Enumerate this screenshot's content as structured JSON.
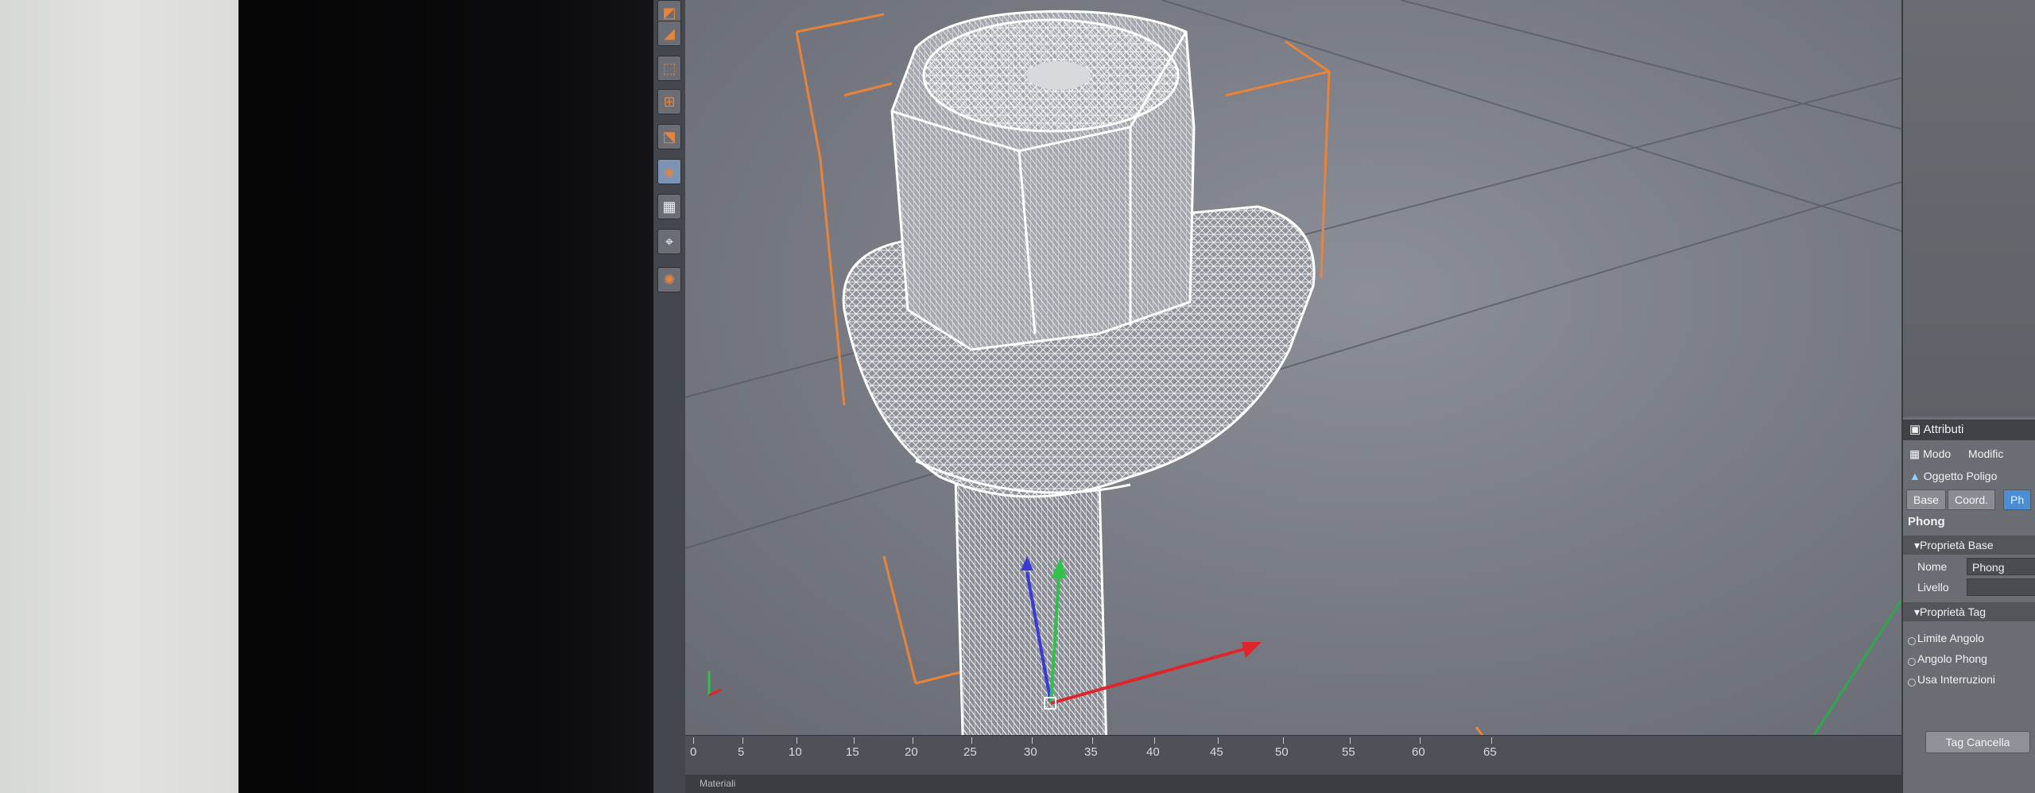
{
  "panel": {
    "title": "Attributi",
    "menu": {
      "mode": "Modo",
      "edit": "Modific"
    },
    "object_name": "Oggetto Poligo",
    "tabs": [
      {
        "label": "Base",
        "active": false
      },
      {
        "label": "Coord.",
        "active": false
      },
      {
        "label": "Ph",
        "active": true
      }
    ],
    "tag_heading": "Phong",
    "sections": {
      "base_props": "Proprietà Base",
      "name_label": "Nome",
      "name_value": "Phong",
      "level_label": "Livello",
      "tag_props": "Proprietà Tag",
      "angle_limit": "Limite Angolo",
      "phong_angle": "Angolo Phong",
      "use_breaks": "Usa Interruzioni"
    },
    "delete_button": "Tag Cancella"
  },
  "timeline": {
    "ticks": [
      "0",
      "5",
      "10",
      "15",
      "20",
      "25",
      "30",
      "35",
      "40",
      "45",
      "50",
      "55",
      "60",
      "65"
    ]
  },
  "material_bar": "Materiali",
  "toolbar": {
    "icons": [
      "model-mode-icon",
      "object-mode-icon",
      "points-mode-icon",
      "edges-mode-icon",
      "polygons-mode-icon",
      "uv-mode-icon",
      "checker-icon",
      "axis-icon",
      "paint-icon"
    ]
  },
  "colors": {
    "accent_orange": "#e8843a",
    "axis_x": "#e0242a",
    "axis_y": "#2ec24a",
    "axis_z": "#3a3ad8",
    "active_tab": "#4a8fd6"
  }
}
